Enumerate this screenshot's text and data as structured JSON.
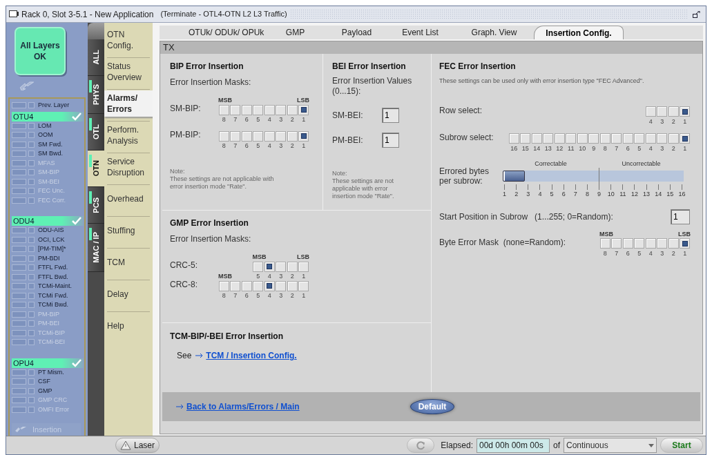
{
  "window": {
    "title": "Rack 0, Slot 3-5.1 - New Application",
    "subtitle": "(Terminate - OTL4-OTN L2 L3 Traffic)"
  },
  "status_button": {
    "label": "All Layers OK"
  },
  "alarm_panel": {
    "prev_layer": "Prev. Layer",
    "groups": [
      {
        "name": "OTU4",
        "ok": true,
        "items": [
          {
            "label": "LOM",
            "disabled": false
          },
          {
            "label": "OOM",
            "disabled": false
          },
          {
            "label": "SM Fwd.",
            "disabled": false
          },
          {
            "label": "SM Bwd.",
            "disabled": false
          },
          {
            "label": "MFAS",
            "disabled": true
          },
          {
            "label": "SM-BIP",
            "disabled": true
          },
          {
            "label": "SM-BEI",
            "disabled": true
          },
          {
            "label": "FEC Unc.",
            "disabled": true
          },
          {
            "label": "FEC Corr.",
            "disabled": true
          }
        ]
      },
      {
        "name": "ODU4",
        "ok": true,
        "items": [
          {
            "label": "ODU-AIS",
            "disabled": false
          },
          {
            "label": "OCI, LCK",
            "disabled": false
          },
          {
            "label": "[PM-TIM]*",
            "disabled": false
          },
          {
            "label": "PM-BDI",
            "disabled": false
          },
          {
            "label": "FTFL Fwd.",
            "disabled": false
          },
          {
            "label": "FTFL Bwd.",
            "disabled": false
          },
          {
            "label": "TCMi-Maint.",
            "disabled": false
          },
          {
            "label": "TCMi Fwd.",
            "disabled": false
          },
          {
            "label": "TCMi Bwd.",
            "disabled": false
          },
          {
            "label": "PM-BIP",
            "disabled": true
          },
          {
            "label": "PM-BEI",
            "disabled": true
          },
          {
            "label": "TCMi-BIP",
            "disabled": true
          },
          {
            "label": "TCMi-BEI",
            "disabled": true
          }
        ]
      },
      {
        "name": "OPU4",
        "ok": true,
        "items": [
          {
            "label": "PT Mism.",
            "disabled": false
          },
          {
            "label": "CSF",
            "disabled": false
          },
          {
            "label": "GMP",
            "disabled": false
          },
          {
            "label": "GMP CRC",
            "disabled": true
          },
          {
            "label": "OMFI Error",
            "disabled": true
          }
        ]
      }
    ]
  },
  "insertion_button": {
    "label": "Insertion",
    "disabled": true
  },
  "layer_tabs": [
    {
      "label": "ALL",
      "selected": false,
      "indicator": false
    },
    {
      "label": "PHYS",
      "selected": false,
      "indicator": true
    },
    {
      "label": "OTL",
      "selected": false,
      "indicator": true
    },
    {
      "label": "OTN",
      "selected": true,
      "indicator": true
    },
    {
      "label": "PCS",
      "selected": false,
      "indicator": true
    },
    {
      "label": "MAC / IP",
      "selected": false,
      "indicator": true
    }
  ],
  "menu": [
    {
      "label": "OTN Config.",
      "selected": false
    },
    {
      "label": "Status Overview",
      "selected": false
    },
    {
      "label": "Alarms/ Errors",
      "selected": true
    },
    {
      "label": "Perform. Analysis",
      "selected": false
    },
    {
      "label": "Service Disruption",
      "selected": false
    },
    {
      "label": "Overhead",
      "selected": false
    },
    {
      "label": "Stuffing",
      "selected": false
    },
    {
      "label": "TCM",
      "selected": false
    },
    {
      "label": "Delay",
      "selected": false
    },
    {
      "label": "Help",
      "selected": false
    }
  ],
  "tabs": [
    {
      "label": "OTUk/ ODUk/ OPUk",
      "selected": false
    },
    {
      "label": "GMP",
      "selected": false
    },
    {
      "label": "Payload",
      "selected": false
    },
    {
      "label": "Event List",
      "selected": false
    },
    {
      "label": "Graph. View",
      "selected": false
    },
    {
      "label": "Insertion Config.",
      "selected": true
    }
  ],
  "section_header": "TX",
  "bip": {
    "title": "BIP Error Insertion",
    "subtitle": "Error Insertion Masks:",
    "msb": "MSB",
    "lsb": "LSB",
    "rows": [
      {
        "label": "SM-BIP:",
        "bits": [
          {
            "label": "8",
            "checked": false
          },
          {
            "label": "7",
            "checked": false
          },
          {
            "label": "6",
            "checked": false
          },
          {
            "label": "5",
            "checked": false
          },
          {
            "label": "4",
            "checked": false
          },
          {
            "label": "3",
            "checked": false
          },
          {
            "label": "2",
            "checked": false
          },
          {
            "label": "1",
            "checked": true
          }
        ]
      },
      {
        "label": "PM-BIP:",
        "bits": [
          {
            "label": "8",
            "checked": false
          },
          {
            "label": "7",
            "checked": false
          },
          {
            "label": "6",
            "checked": false
          },
          {
            "label": "5",
            "checked": false
          },
          {
            "label": "4",
            "checked": false
          },
          {
            "label": "3",
            "checked": false
          },
          {
            "label": "2",
            "checked": false
          },
          {
            "label": "1",
            "checked": true
          }
        ]
      }
    ],
    "note": "Note:\nThese settings are not applicable with\nerror insertion mode \"Rate\"."
  },
  "bei": {
    "title": "BEI Error Insertion",
    "subtitle": "Error Insertion Values\n (0...15):",
    "fields": [
      {
        "label": "SM-BEI:",
        "value": "1"
      },
      {
        "label": "PM-BEI:",
        "value": "1"
      }
    ],
    "note": "Note:\nThese settings are not\napplicable with error\ninsertion mode \"Rate\"."
  },
  "gmp": {
    "title": "GMP Error Insertion",
    "subtitle": "Error Insertion Masks:",
    "rows": [
      {
        "label": "CRC-5:",
        "msb": "MSB",
        "lsb": "LSB",
        "bits": [
          {
            "label": "5",
            "checked": false
          },
          {
            "label": "4",
            "checked": true
          },
          {
            "label": "3",
            "checked": false
          },
          {
            "label": "2",
            "checked": false
          },
          {
            "label": "1",
            "checked": false
          }
        ]
      },
      {
        "label": "CRC-8:",
        "msb": "MSB",
        "bits": [
          {
            "label": "8",
            "checked": false
          },
          {
            "label": "7",
            "checked": false
          },
          {
            "label": "6",
            "checked": false
          },
          {
            "label": "5",
            "checked": false
          },
          {
            "label": "4",
            "checked": true
          },
          {
            "label": "3",
            "checked": false
          },
          {
            "label": "2",
            "checked": false
          },
          {
            "label": "1",
            "checked": false
          }
        ]
      }
    ]
  },
  "tcm": {
    "title": "TCM-BIP/-BEI Error Insertion",
    "see": "See",
    "link": "TCM / Insertion Config."
  },
  "fec": {
    "title": "FEC Error Insertion",
    "note": "These settings can be used only with error insertion type \"FEC Advanced\".",
    "row_select": {
      "label": "Row select:",
      "bits": [
        {
          "label": "4",
          "checked": false
        },
        {
          "label": "3",
          "checked": false
        },
        {
          "label": "2",
          "checked": false
        },
        {
          "label": "1",
          "checked": true
        }
      ]
    },
    "subrow_select": {
      "label": "Subrow select:",
      "bits": [
        {
          "label": "16",
          "checked": false
        },
        {
          "label": "15",
          "checked": false
        },
        {
          "label": "14",
          "checked": false
        },
        {
          "label": "13",
          "checked": false
        },
        {
          "label": "12",
          "checked": false
        },
        {
          "label": "11",
          "checked": false
        },
        {
          "label": "10",
          "checked": false
        },
        {
          "label": "9",
          "checked": false
        },
        {
          "label": "8",
          "checked": false
        },
        {
          "label": "7",
          "checked": false
        },
        {
          "label": "6",
          "checked": false
        },
        {
          "label": "5",
          "checked": false
        },
        {
          "label": "4",
          "checked": false
        },
        {
          "label": "3",
          "checked": false
        },
        {
          "label": "2",
          "checked": false
        },
        {
          "label": "1",
          "checked": true
        }
      ]
    },
    "errored_bytes": {
      "label": "Errored bytes\nper subrow:",
      "zones": [
        "Correctable",
        "Uncorrectable"
      ],
      "level": 0,
      "ticks": [
        "1",
        "2",
        "3",
        "4",
        "5",
        "6",
        "7",
        "8",
        "9",
        "10",
        "11",
        "12",
        "13",
        "14",
        "15",
        "16"
      ]
    },
    "start_position": {
      "label": "Start Position in Subrow   (1...255; 0=Random):",
      "value": "1"
    },
    "byte_error_mask": {
      "label": "Byte Error Mask  (none=Random):",
      "msb": "MSB",
      "lsb": "LSB",
      "bits": [
        {
          "label": "8",
          "checked": false
        },
        {
          "label": "7",
          "checked": false
        },
        {
          "label": "6",
          "checked": false
        },
        {
          "label": "5",
          "checked": false
        },
        {
          "label": "4",
          "checked": false
        },
        {
          "label": "3",
          "checked": false
        },
        {
          "label": "2",
          "checked": false
        },
        {
          "label": "1",
          "checked": true
        }
      ]
    }
  },
  "footer": {
    "back_link": "Back to Alarms/Errors / Main",
    "default_button": "Default"
  },
  "bottom_bar": {
    "laser_button": "Laser",
    "elapsed_label": "Elapsed:",
    "elapsed": "00d 00h 00m 00s",
    "of": "of",
    "mode": "Continuous",
    "start_button": "Start"
  }
}
